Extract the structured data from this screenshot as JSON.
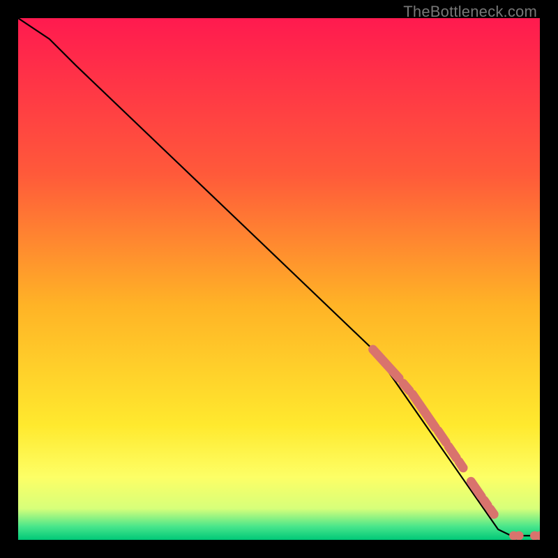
{
  "watermark": "TheBottleneck.com",
  "colors": {
    "gradient_stops": [
      {
        "offset": 0.0,
        "color": "#ff1a4f"
      },
      {
        "offset": 0.3,
        "color": "#ff5a3a"
      },
      {
        "offset": 0.55,
        "color": "#ffb326"
      },
      {
        "offset": 0.78,
        "color": "#ffe92e"
      },
      {
        "offset": 0.88,
        "color": "#fdff66"
      },
      {
        "offset": 0.94,
        "color": "#d7ff7a"
      },
      {
        "offset": 0.975,
        "color": "#47e58b"
      },
      {
        "offset": 1.0,
        "color": "#00c878"
      }
    ],
    "line": "#000000",
    "marker_fill": "#d9736d",
    "marker_stroke": "#b95a55"
  },
  "chart_data": {
    "type": "line",
    "title": "",
    "xlabel": "",
    "ylabel": "",
    "x_range": [
      0,
      100
    ],
    "y_range": [
      0,
      100
    ],
    "line_points": [
      {
        "x": 0,
        "y": 100
      },
      {
        "x": 6,
        "y": 96
      },
      {
        "x": 11,
        "y": 91
      },
      {
        "x": 68,
        "y": 36.5
      },
      {
        "x": 92,
        "y": 2
      },
      {
        "x": 94.5,
        "y": 0.8
      },
      {
        "x": 100,
        "y": 0.8
      }
    ],
    "marker_segments": [
      {
        "x0": 68.0,
        "y0": 36.5,
        "x1": 73.0,
        "y1": 31.0
      },
      {
        "x0": 73.8,
        "y0": 30.0,
        "x1": 75.0,
        "y1": 28.6
      },
      {
        "x0": 75.6,
        "y0": 27.9,
        "x1": 80.0,
        "y1": 21.5
      },
      {
        "x0": 80.5,
        "y0": 20.9,
        "x1": 82.0,
        "y1": 18.7
      },
      {
        "x0": 82.5,
        "y0": 17.9,
        "x1": 84.0,
        "y1": 15.7
      },
      {
        "x0": 84.5,
        "y0": 15.0,
        "x1": 85.3,
        "y1": 13.8
      },
      {
        "x0": 86.8,
        "y0": 11.2,
        "x1": 88.8,
        "y1": 8.3
      },
      {
        "x0": 89.3,
        "y0": 7.6,
        "x1": 90.0,
        "y1": 6.6
      },
      {
        "x0": 90.5,
        "y0": 5.9,
        "x1": 91.2,
        "y1": 4.9
      }
    ],
    "marker_points": [
      {
        "x": 95.0,
        "y": 0.8
      },
      {
        "x": 96.0,
        "y": 0.8
      },
      {
        "x": 99.0,
        "y": 0.8
      },
      {
        "x": 100.0,
        "y": 0.8
      }
    ]
  }
}
